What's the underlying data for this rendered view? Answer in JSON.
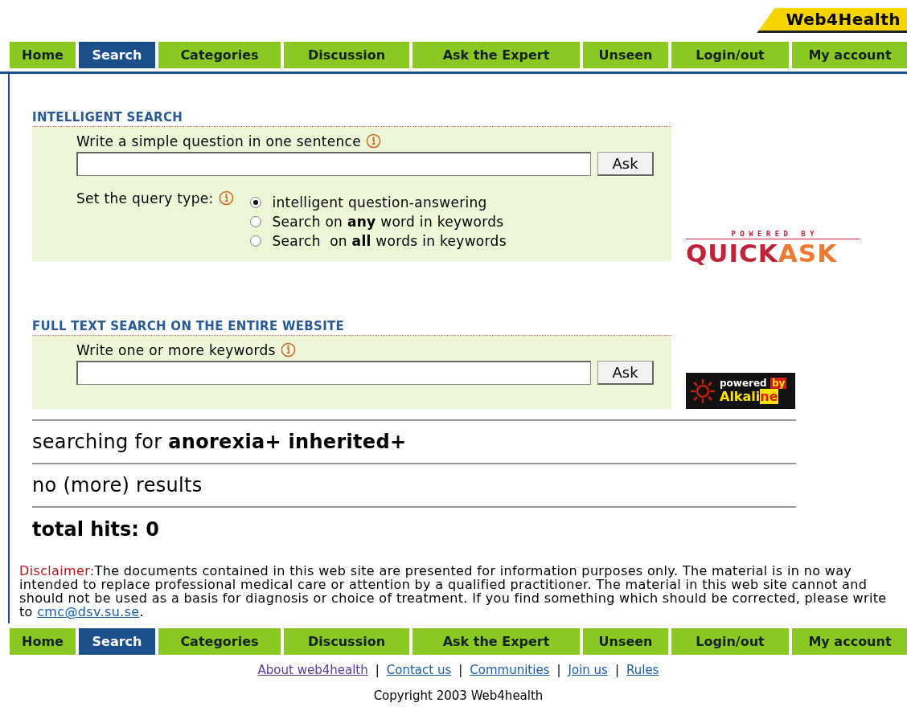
{
  "logo": {
    "text": "Web4Health"
  },
  "nav": [
    {
      "label": "Home",
      "selected": false
    },
    {
      "label": "Search",
      "selected": true
    },
    {
      "label": "Categories",
      "selected": false
    },
    {
      "label": "Discussion",
      "selected": false
    },
    {
      "label": "Ask the Expert",
      "selected": false
    },
    {
      "label": "Unseen",
      "selected": false
    },
    {
      "label": "Login/out",
      "selected": false
    },
    {
      "label": "My account",
      "selected": false
    }
  ],
  "intelligent_search": {
    "heading": "INTELLIGENT SEARCH",
    "question_label": "Write a simple question in one sentence",
    "button": "Ask",
    "query_type_label": "Set the query type:",
    "options": [
      {
        "label": "intelligent question-answering",
        "selected": true
      },
      {
        "label": "Search on **any** word in keywords",
        "selected": false
      },
      {
        "label": "Search  on **all** words in keywords",
        "selected": false
      }
    ]
  },
  "quickask_badge": {
    "powered_by": "P O W E R E D   B Y",
    "name_first": "QUICK",
    "name_second": "ASK"
  },
  "full_text_search": {
    "heading": "FULL TEXT SEARCH ON THE ENTIRE WEBSITE",
    "keywords_label": "Write one or more keywords",
    "button": "Ask"
  },
  "alkaline_badge": {
    "powered": "powered",
    "by": "by",
    "name_first": "Alkali",
    "name_second": "ne"
  },
  "results": {
    "searching_for": "searching for **anorexia+ inherited+**",
    "status": "no (more) results",
    "total": "total hits: 0"
  },
  "disclaimer": {
    "label": "Disclaimer:",
    "text": "The documents contained in this web site are presented for information purposes only. The material is in no way intended to replace professional medical care or attention by a qualified practitioner. The material in this web site cannot and should not be used as a basis for diagnosis or choice of treatment. If you find something which should be corrected, please write to ",
    "email": "cmc@dsv.su.se",
    "end": "."
  },
  "bottom_nav": [
    {
      "label": "Home",
      "selected": false
    },
    {
      "label": "Search",
      "selected": true
    },
    {
      "label": "Categories",
      "selected": false
    },
    {
      "label": "Discussion",
      "selected": false
    },
    {
      "label": "Ask the Expert",
      "selected": false
    },
    {
      "label": "Unseen",
      "selected": false
    },
    {
      "label": "Login/out",
      "selected": false
    },
    {
      "label": "My account",
      "selected": false
    }
  ],
  "footer_links": [
    {
      "kind": "link",
      "label": "About web4health",
      "visited": true
    },
    {
      "kind": "separator",
      "label": "|"
    },
    {
      "kind": "link",
      "label": "Contact us",
      "visited": false
    },
    {
      "kind": "separator",
      "label": "|"
    },
    {
      "kind": "link",
      "label": "Communities",
      "visited": false
    },
    {
      "kind": "separator",
      "label": "|"
    },
    {
      "kind": "link",
      "label": "Join us",
      "visited": false
    },
    {
      "kind": "separator",
      "label": "|"
    },
    {
      "kind": "link",
      "label": "Rules",
      "visited": false
    }
  ],
  "copyright": "Copyright 2003 Web4health"
}
